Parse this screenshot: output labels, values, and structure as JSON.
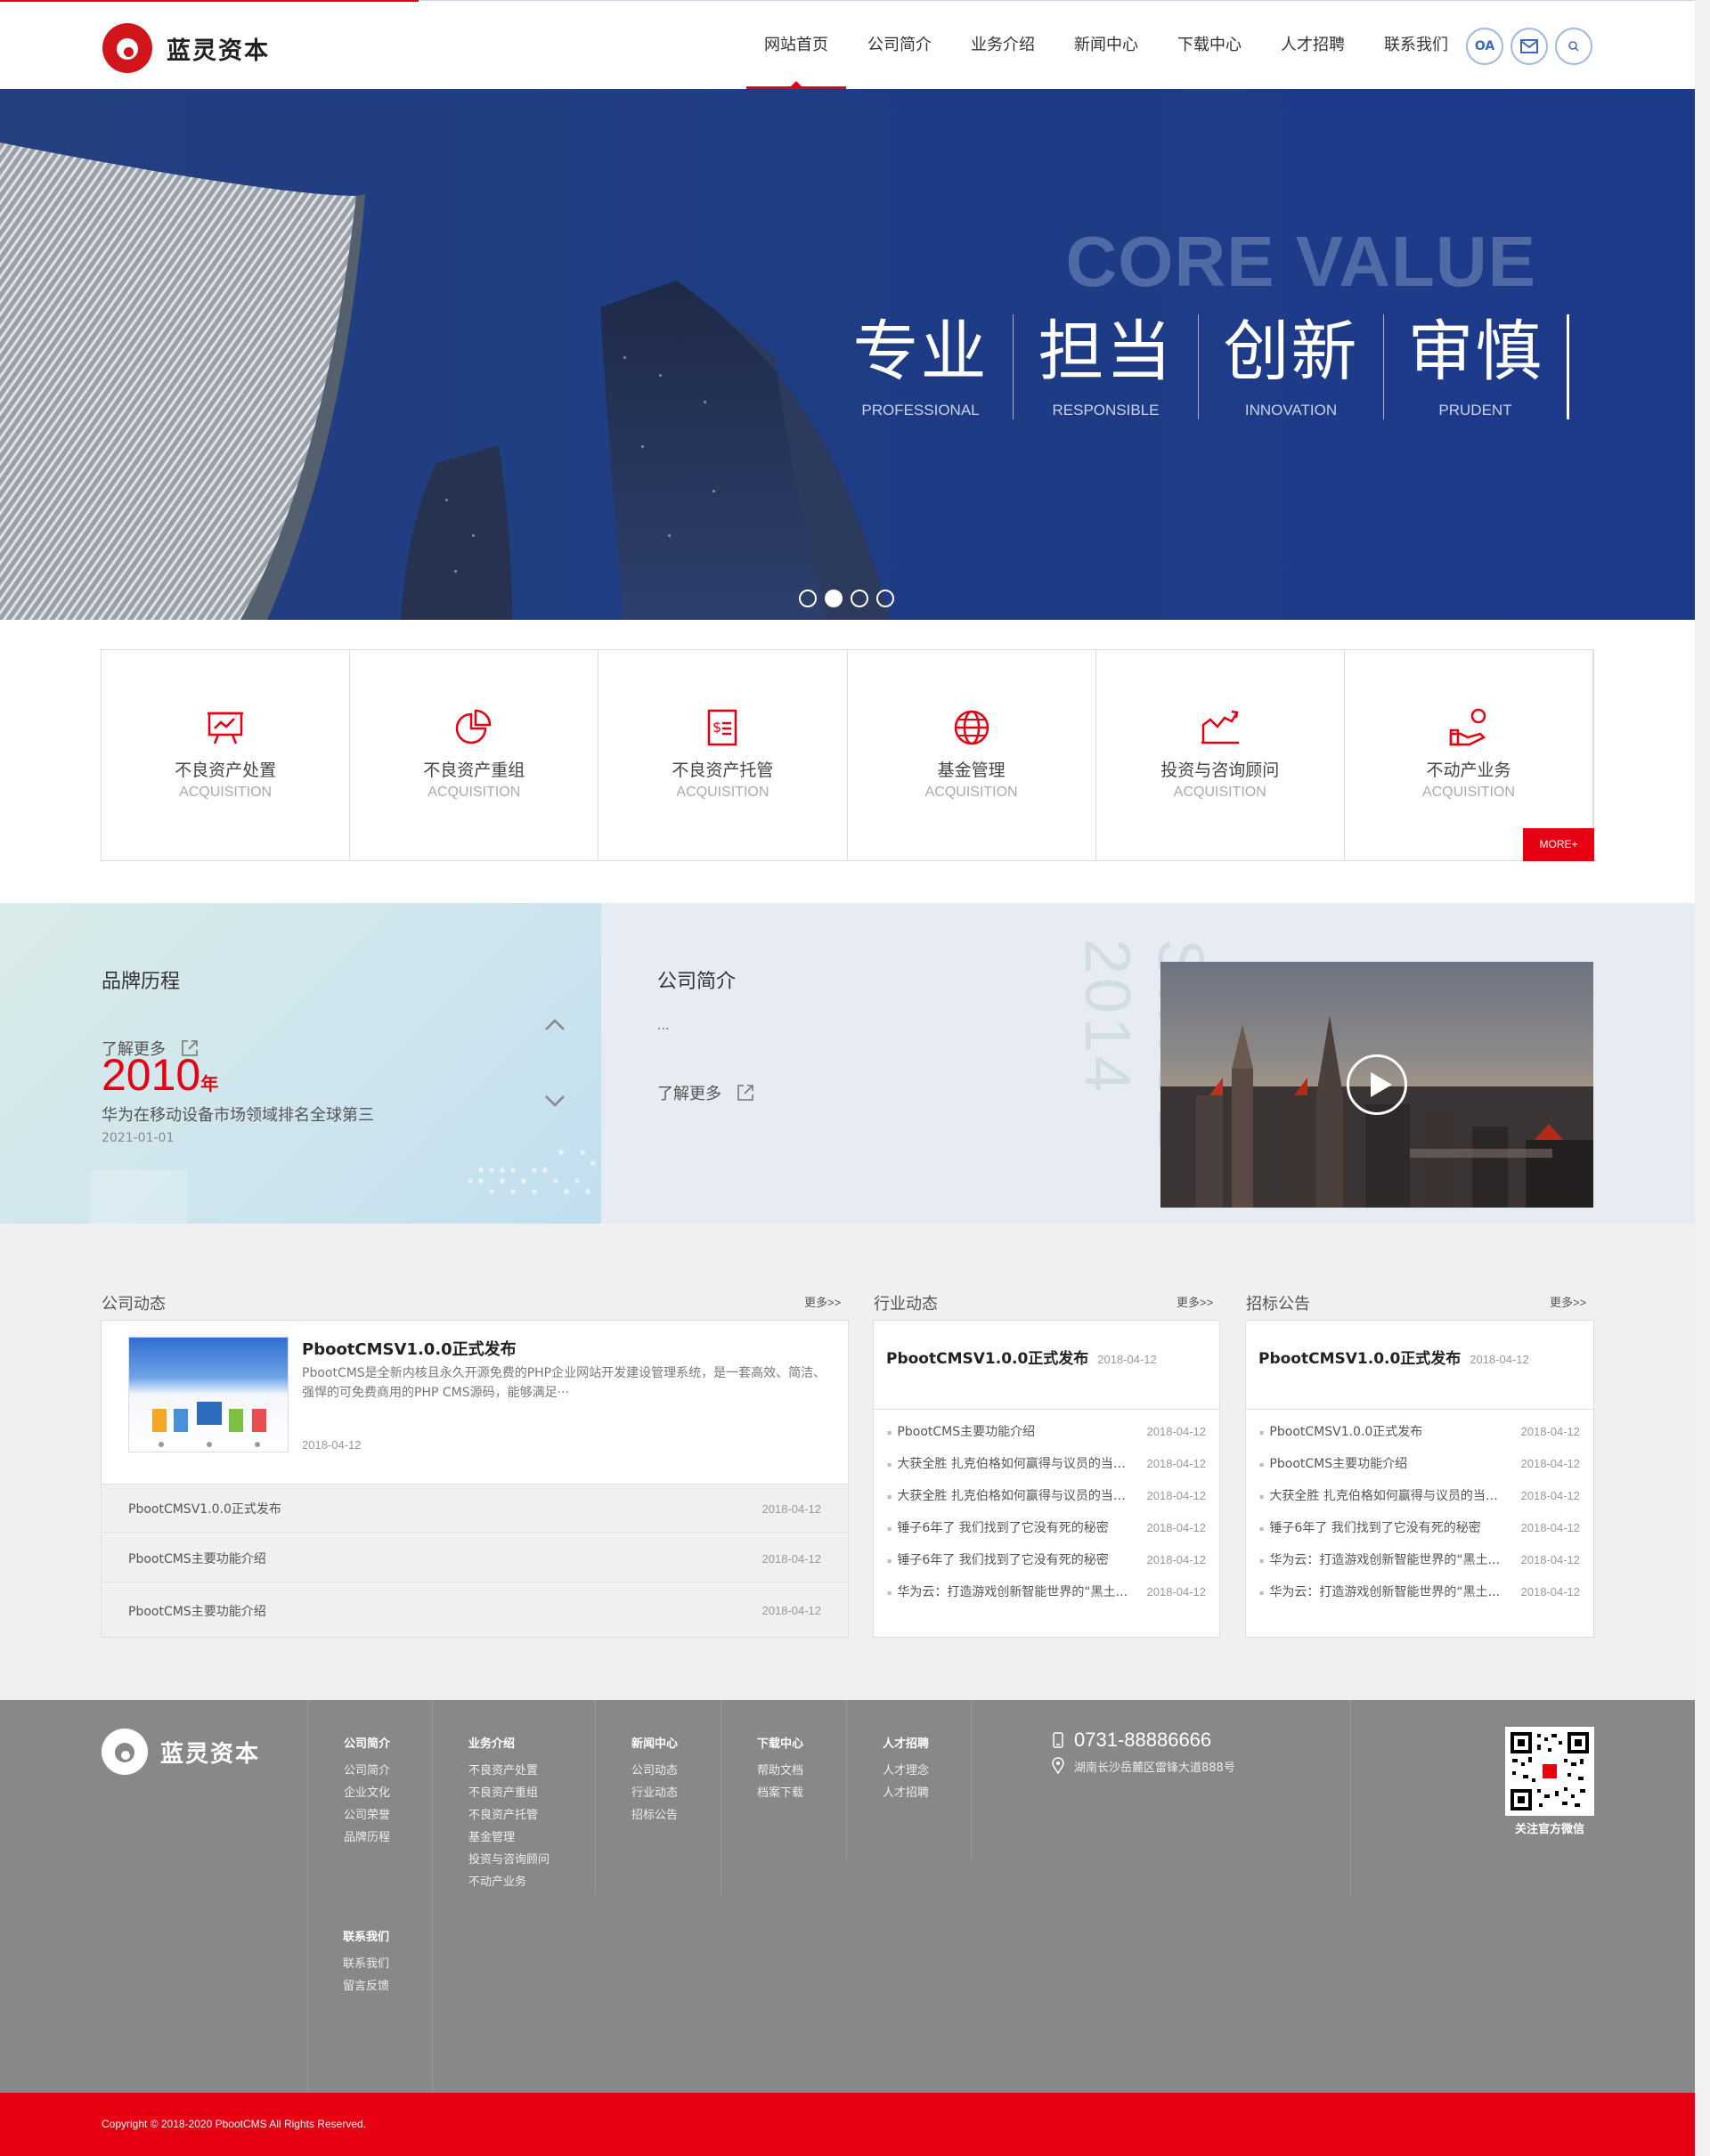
{
  "header": {
    "brand": "蓝灵资本",
    "nav": [
      "网站首页",
      "公司简介",
      "业务介绍",
      "新闻中心",
      "下载中心",
      "人才招聘",
      "联系我们"
    ],
    "icons": [
      "OA",
      "mail-icon",
      "search-icon"
    ],
    "oa_label": "OA"
  },
  "banner": {
    "headline": "CORE VALUE",
    "values": [
      {
        "zh": "专业",
        "en": "PROFESSIONAL"
      },
      {
        "zh": "担当",
        "en": "RESPONSIBLE"
      },
      {
        "zh": "创新",
        "en": "INNOVATION"
      },
      {
        "zh": "审慎",
        "en": "PRUDENT"
      }
    ],
    "slides": 4,
    "active_slide": 2
  },
  "services": {
    "items": [
      {
        "name": "不良资产处置",
        "en": "ACQUISITION",
        "icon": "presentation-board-icon"
      },
      {
        "name": "不良资产重组",
        "en": "ACQUISITION",
        "icon": "pie-chart-icon"
      },
      {
        "name": "不良资产托管",
        "en": "ACQUISITION",
        "icon": "dollar-document-icon"
      },
      {
        "name": "基金管理",
        "en": "ACQUISITION",
        "icon": "globe-icon"
      },
      {
        "name": "投资与咨询顾问",
        "en": "ACQUISITION",
        "icon": "trend-chart-icon"
      },
      {
        "name": "不动产业务",
        "en": "ACQUISITION",
        "icon": "hand-coin-icon"
      }
    ],
    "more": "MORE+"
  },
  "brand": {
    "title": "品牌历程",
    "learn_more": "了解更多",
    "year": "2010",
    "year_suffix": "年",
    "desc": "华为在移动设备市场领域排名全球第三",
    "date": "2021-01-01"
  },
  "intro": {
    "title": "公司简介",
    "excerpt": "...",
    "learn_more": "了解更多",
    "since": "SINCE 2014"
  },
  "news": {
    "company": {
      "title": "公司动态",
      "more": "更多>>",
      "feature_title": "PbootCMSV1.0.0正式发布",
      "feature_desc": "PbootCMS是全新内核且永久开源免费的PHP企业网站开发建设管理系统，是一套高效、简洁、 强悍的可免费商用的PHP CMS源码，能够满足···",
      "feature_date": "2018-04-12",
      "rows": [
        {
          "title": "PbootCMSV1.0.0正式发布",
          "date": "2018-04-12"
        },
        {
          "title": "PbootCMS主要功能介绍",
          "date": "2018-04-12"
        },
        {
          "title": "PbootCMS主要功能介绍",
          "date": "2018-04-12"
        }
      ]
    },
    "industry": {
      "title": "行业动态",
      "more": "更多>>",
      "feature_title": "PbootCMSV1.0.0正式发布",
      "feature_date": "2018-04-12",
      "rows": [
        {
          "title": "PbootCMS主要功能介绍",
          "date": "2018-04-12"
        },
        {
          "title": "大获全胜 扎克伯格如何赢得与议员的当面...",
          "date": "2018-04-12"
        },
        {
          "title": "大获全胜 扎克伯格如何赢得与议员的当面...",
          "date": "2018-04-12"
        },
        {
          "title": "锤子6年了 我们找到了它没有死的秘密",
          "date": "2018-04-12"
        },
        {
          "title": "锤子6年了 我们找到了它没有死的秘密",
          "date": "2018-04-12"
        },
        {
          "title": "华为云：打造游戏创新智能世界的“黑土...",
          "date": "2018-04-12"
        }
      ]
    },
    "tender": {
      "title": "招标公告",
      "more": "更多>>",
      "feature_title": "PbootCMSV1.0.0正式发布",
      "feature_date": "2018-04-12",
      "rows": [
        {
          "title": "PbootCMSV1.0.0正式发布",
          "date": "2018-04-12"
        },
        {
          "title": "PbootCMS主要功能介绍",
          "date": "2018-04-12"
        },
        {
          "title": "大获全胜 扎克伯格如何赢得与议员的当面...",
          "date": "2018-04-12"
        },
        {
          "title": "锤子6年了 我们找到了它没有死的秘密",
          "date": "2018-04-12"
        },
        {
          "title": "华为云：打造游戏创新智能世界的“黑土...",
          "date": "2018-04-12"
        },
        {
          "title": "华为云：打造游戏创新智能世界的“黑土...",
          "date": "2018-04-12"
        }
      ]
    }
  },
  "footer": {
    "brand": "蓝灵资本",
    "columns": [
      {
        "title": "公司简介",
        "links": [
          "公司简介",
          "企业文化",
          "公司荣誉",
          "品牌历程"
        ]
      },
      {
        "title": "业务介绍",
        "links": [
          "不良资产处置",
          "不良资产重组",
          "不良资产托管",
          "基金管理",
          "投资与咨询顾问",
          "不动产业务"
        ]
      },
      {
        "title": "新闻中心",
        "links": [
          "公司动态",
          "行业动态",
          "招标公告"
        ]
      },
      {
        "title": "下载中心",
        "links": [
          "帮助文档",
          "档案下载"
        ]
      },
      {
        "title": "人才招聘",
        "links": [
          "人才理念",
          "人才招聘"
        ]
      },
      {
        "title": "联系我们",
        "links": [
          "联系我们",
          "留言反馈"
        ]
      }
    ],
    "phone": "0731-88886666",
    "address": "湖南长沙岳麓区雷锋大道888号",
    "qr_caption": "关注官方微信",
    "copyright": "Copyright © 2018-2020 PbootCMS All Rights Reserved."
  }
}
